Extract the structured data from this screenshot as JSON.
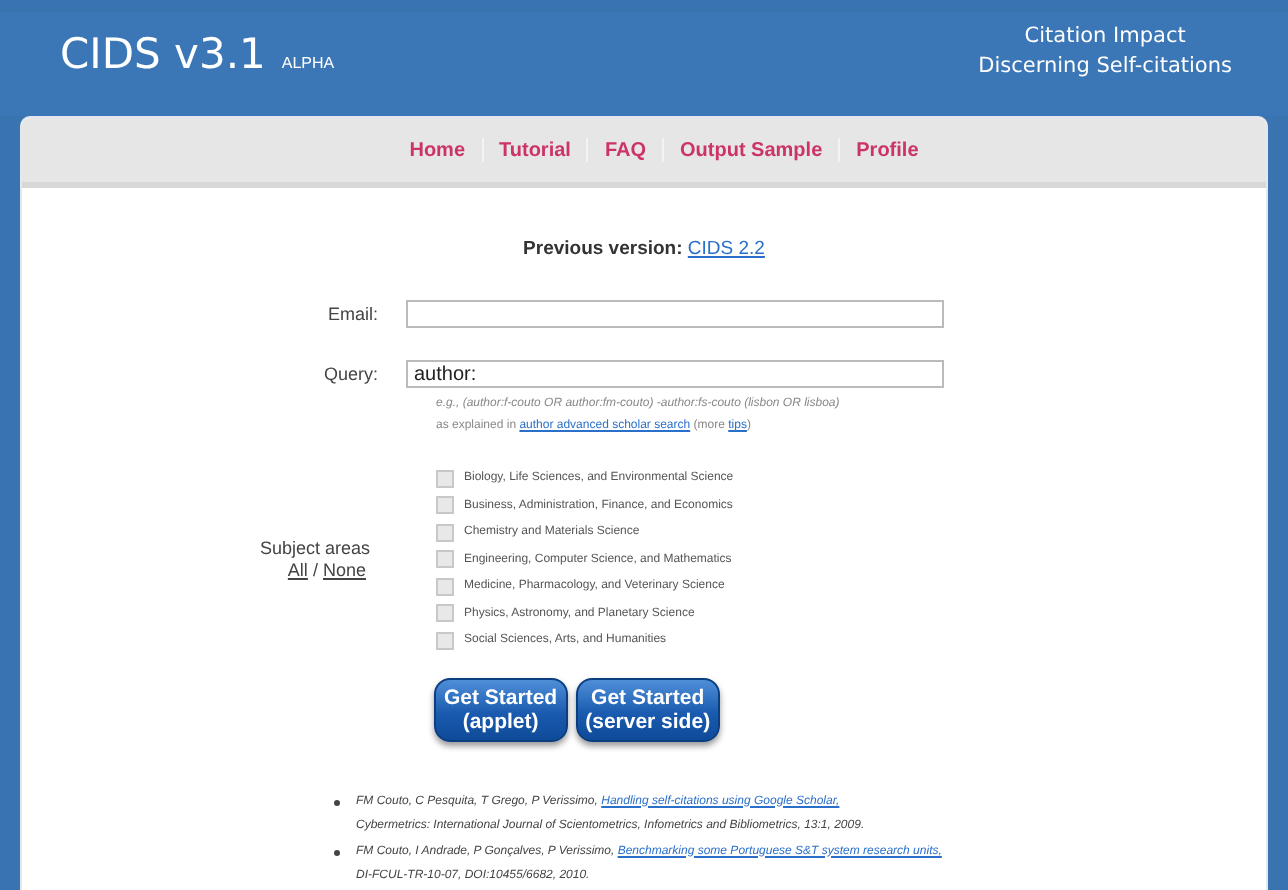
{
  "header": {
    "title": "CIDS v3.1",
    "badge": "ALPHA",
    "tagline": [
      "Citation Impact",
      "Discerning Self-citations"
    ]
  },
  "nav": [
    {
      "label": "Home"
    },
    {
      "label": "Tutorial"
    },
    {
      "label": "FAQ"
    },
    {
      "label": "Output Sample"
    },
    {
      "label": "Profile"
    }
  ],
  "previous_version": {
    "label": "Previous version:",
    "link": "CIDS 2.2"
  },
  "email": {
    "label": "Email:"
  },
  "query": {
    "label": "Query:",
    "value": "author:"
  },
  "hint": {
    "example": "e.g., (author:f-couto OR author:fm-couto) -author:fs-couto (lisbon OR lisboa)",
    "prefix": "as explained in",
    "link": "author advanced scholar search",
    "more": "(more",
    "tips": "tips",
    "close": ")"
  },
  "subject_areas": {
    "label": "Subject areas",
    "all": "All",
    "sep": "/",
    "none": "None",
    "items": [
      {
        "label": "Biology, Life Sciences, and Environmental Science",
        "checked": false
      },
      {
        "label": "Business, Administration, Finance, and Economics",
        "checked": false
      },
      {
        "label": "Chemistry and Materials Science",
        "checked": false
      },
      {
        "label": "Engineering, Computer Science, and Mathematics",
        "checked": false
      },
      {
        "label": "Medicine, Pharmacology, and Veterinary Science",
        "checked": false
      },
      {
        "label": "Physics, Astronomy, and Planetary Science",
        "checked": false
      },
      {
        "label": "Social Sciences, Arts, and Humanities",
        "checked": false
      }
    ]
  },
  "buttons": [
    [
      "Get Started",
      "(applet)"
    ],
    [
      "Get Started",
      "(server side)"
    ]
  ],
  "references": [
    {
      "authors": "FM Couto, C Pesquita, T Grego, P Verissimo,",
      "link": "Handling self-citations using Google Scholar,",
      "source": "Cybermetrics: International Journal of Scientometrics, Infometrics and Bibliometrics, 13:1, 2009."
    },
    {
      "authors": "FM Couto, I Andrade, P Gonçalves, P Verissimo,",
      "link": "Benchmarking some Portuguese S&T system research units,",
      "source": "DI-FCUL-TR-10-07, DOI:10455/6682, 2010."
    }
  ]
}
